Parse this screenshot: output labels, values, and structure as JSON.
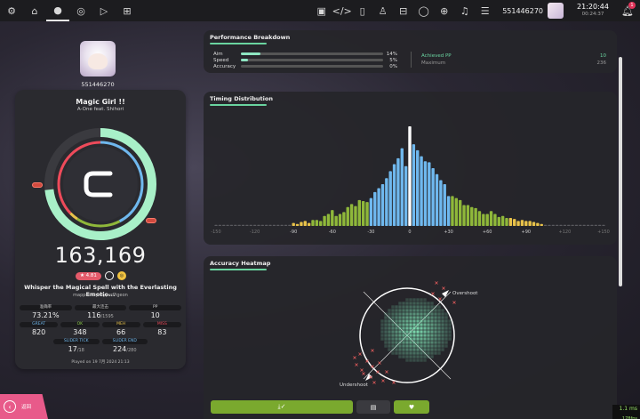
{
  "topbar": {
    "left_icons": [
      "settings-icon",
      "home-icon",
      "play-mode-osu-icon",
      "play-mode-taiko-icon",
      "play-mode-catch-icon",
      "play-mode-mania-icon"
    ],
    "left_glyphs": [
      "⚙",
      "⌂",
      "●",
      "◎",
      "▷",
      "⊞"
    ],
    "right_icons": [
      "screenshot-icon",
      "code-icon",
      "beatmap-listing-icon",
      "rankings-icon",
      "changelog-icon",
      "chat-icon",
      "dashboard-icon",
      "music-icon",
      "notes-icon"
    ],
    "right_glyphs": [
      "▣",
      "</>",
      "▯",
      "♙",
      "⊟",
      "◯",
      "⊕",
      "♫",
      "☰"
    ],
    "username": "551446270",
    "time": "21:20:44",
    "session": "00:24:37",
    "notification_count": "1"
  },
  "profile": {
    "name": "551446270"
  },
  "result": {
    "title": "Magic Girl !!",
    "artist": "A-One feat. Shihori",
    "score": "163,169",
    "stars": "★ 4.81",
    "mod_label": "◎",
    "difficulty": "Whisper the Magical Spell with the Everlasting Emotio...",
    "mapper": "mapped by HyperPigeon",
    "accuracy_fraction": 0.7321,
    "stats_row1": [
      {
        "label": "准确率",
        "value": "73.21%",
        "sub": ""
      },
      {
        "label": "最大连击",
        "value": "116",
        "sub": "/1595"
      },
      {
        "label": "PP",
        "value": "10",
        "sub": ""
      }
    ],
    "stats_row2": [
      {
        "label": "GREAT",
        "value": "820",
        "sub": ""
      },
      {
        "label": "OK",
        "value": "348",
        "sub": ""
      },
      {
        "label": "MEH",
        "value": "66",
        "sub": ""
      },
      {
        "label": "MISS",
        "value": "83",
        "sub": ""
      }
    ],
    "stats_row3": [
      {
        "label": "SLIDER TICK",
        "value": "17",
        "sub": "/18"
      },
      {
        "label": "SLIDER END",
        "value": "224",
        "sub": "/280"
      }
    ],
    "played": "Played on 19 7月 2024 21:13"
  },
  "performance": {
    "title": "Performance Breakdown",
    "rows": [
      {
        "name": "Aim",
        "value": "14%",
        "fraction": 0.14
      },
      {
        "name": "Speed",
        "value": "5%",
        "fraction": 0.05
      },
      {
        "name": "Accuracy",
        "value": "0%",
        "fraction": 0.0
      }
    ],
    "pp": [
      {
        "name": "Achieved PP",
        "value": "10"
      },
      {
        "name": "Maximum",
        "value": "236"
      }
    ]
  },
  "timing": {
    "title": "Timing Distribution",
    "ticks": [
      "-150",
      "-120",
      "-90",
      "-60",
      "-30",
      "0",
      "+30",
      "+60",
      "+90",
      "+120",
      "+150"
    ]
  },
  "heatmap": {
    "title": "Accuracy Heatmap",
    "overshoot": "Overshoot",
    "undershoot": "Undershoot"
  },
  "chart_data": {
    "type": "bar",
    "title": "Timing Distribution",
    "x_unit": "ms",
    "x": [
      -150,
      -147,
      -144,
      -141,
      -138,
      -135,
      -132,
      -129,
      -126,
      -123,
      -120,
      -117,
      -114,
      -111,
      -108,
      -105,
      -102,
      -99,
      -96,
      -93,
      -90,
      -87,
      -84,
      -81,
      -78,
      -75,
      -72,
      -69,
      -66,
      -63,
      -60,
      -57,
      -54,
      -51,
      -48,
      -45,
      -42,
      -39,
      -36,
      -33,
      -30,
      -27,
      -24,
      -21,
      -18,
      -15,
      -12,
      -9,
      -6,
      -3,
      0,
      3,
      6,
      9,
      12,
      15,
      18,
      21,
      24,
      27,
      30,
      33,
      36,
      39,
      42,
      45,
      48,
      51,
      54,
      57,
      60,
      63,
      66,
      69,
      72,
      75,
      78,
      81,
      84,
      87,
      90,
      93,
      96,
      99,
      102,
      105,
      108,
      111,
      114,
      117,
      120,
      123,
      126,
      129,
      132,
      135,
      138,
      141,
      144,
      147,
      150
    ],
    "values": [
      0,
      0,
      0,
      0,
      0,
      0,
      0,
      0,
      0,
      0,
      0,
      0,
      0,
      0,
      0,
      0,
      0,
      0,
      0,
      0,
      3,
      2,
      4,
      5,
      3,
      6,
      6,
      5,
      10,
      12,
      16,
      10,
      12,
      14,
      19,
      22,
      20,
      26,
      25,
      24,
      28,
      34,
      38,
      42,
      48,
      55,
      62,
      68,
      78,
      60,
      100,
      82,
      76,
      70,
      65,
      64,
      58,
      52,
      46,
      42,
      30,
      30,
      28,
      26,
      21,
      21,
      19,
      18,
      15,
      12,
      12,
      15,
      12,
      9,
      10,
      8,
      8,
      7,
      5,
      6,
      5,
      5,
      4,
      3,
      2,
      0,
      0,
      0,
      0,
      0,
      0,
      0,
      0,
      0,
      0,
      0,
      0,
      0,
      0,
      0,
      0
    ],
    "xlim": [
      -150,
      150
    ],
    "legend": "none",
    "color_regions": {
      "great": "#6fb8ee",
      "ok": "#8fb83a",
      "meh": "#e8c24a",
      "center": "#ffffff"
    }
  }
}
